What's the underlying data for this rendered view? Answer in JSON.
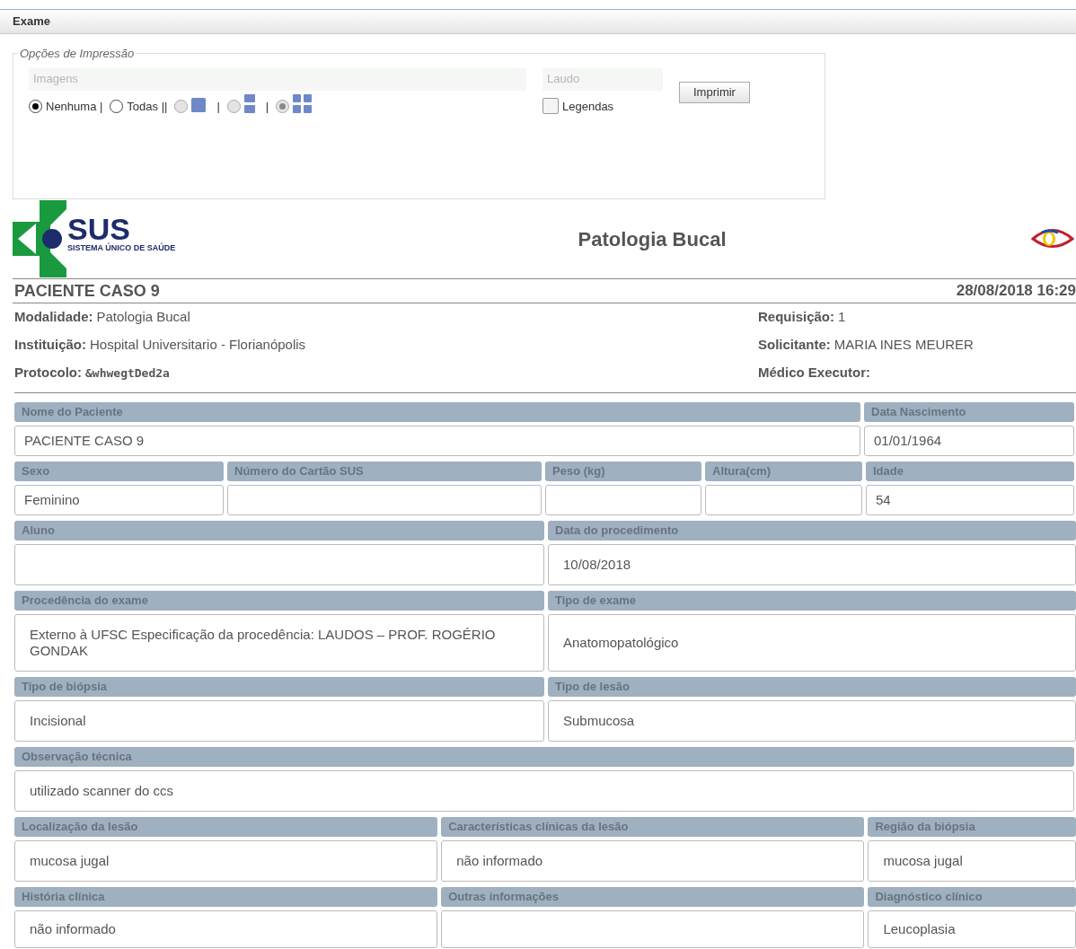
{
  "panel": {
    "title": "Exame"
  },
  "print_options": {
    "legend": "Opções de Impressão",
    "images_label": "Imagens",
    "image_options": [
      {
        "kind": "text",
        "label": "Nenhuma |",
        "selected": true,
        "disabled": false
      },
      {
        "kind": "text",
        "label": "Todas ||",
        "selected": false,
        "disabled": false
      },
      {
        "kind": "single",
        "label": "|",
        "selected": false,
        "disabled": true
      },
      {
        "kind": "column",
        "label": "|",
        "selected": false,
        "disabled": true
      },
      {
        "kind": "grid",
        "selected": true,
        "disabled": true
      }
    ],
    "report_label": "Laudo",
    "legends": {
      "label": "Legendas",
      "checked": false
    },
    "print_button": "Imprimir"
  },
  "header": {
    "logo_text": "SUS",
    "logo_subtitle": "SISTEMA ÚNICO DE SAÚDE",
    "title": "Patologia Bucal"
  },
  "patient": {
    "name": "PACIENTE CASO 9",
    "datetime": "28/08/2018 16:29"
  },
  "info_left": [
    {
      "label": "Modalidade:",
      "value": "Patologia Bucal",
      "kind": "text"
    },
    {
      "label": "Instituição:",
      "value": "Hospital Universitario - Florianópolis",
      "kind": "text"
    },
    {
      "label": "Protocolo:",
      "value": "&whwegtDed2a",
      "kind": "code"
    }
  ],
  "info_right": [
    {
      "label": "Requisição:",
      "value": "1"
    },
    {
      "label": "Solicitante:",
      "value": "MARIA INES MEURER"
    },
    {
      "label": "Médico Executor:"
    }
  ],
  "form_rows": [
    [
      {
        "label": "Nome do Paciente",
        "value": "PACIENTE CASO 9"
      },
      {
        "label": "Data Nascimento",
        "value": "01/01/1964"
      }
    ],
    [
      {
        "label": "Sexo",
        "value": "Feminino"
      },
      {
        "label": "Número do Cartão SUS"
      },
      {
        "label": "Peso (kg)"
      },
      {
        "label": "Altura(cm)"
      },
      {
        "label": "Idade",
        "value": "54"
      }
    ],
    [
      {
        "label": "Aluno"
      },
      {
        "label": "Data do procedimento",
        "value": "10/08/2018"
      }
    ],
    [
      {
        "label": "Procedência do exame",
        "value": "Externo à UFSC  Especificação da procedência: LAUDOS – PROF. ROGÉRIO GONDAK"
      },
      {
        "label": "Tipo de exame",
        "value": "Anatomopatológico"
      }
    ],
    [
      {
        "label": "Tipo de biópsia",
        "value": "Incisional"
      },
      {
        "label": "Tipo de lesão",
        "value": "Submucosa"
      }
    ],
    [
      {
        "label": "Observação técnica",
        "value": "utilizado scanner do ccs"
      }
    ],
    [
      {
        "label": "Localização da lesão",
        "value": "mucosa jugal"
      },
      {
        "label": "Características clínicas da lesão",
        "value": "não informado"
      },
      {
        "label": "Região da biópsia",
        "value": "mucosa jugal"
      }
    ],
    [
      {
        "label": "História clínica",
        "value": "não informado"
      },
      {
        "label": "Outras informações"
      },
      {
        "label": "Diagnóstico clínico",
        "value": "Leucoplasia"
      }
    ]
  ]
}
